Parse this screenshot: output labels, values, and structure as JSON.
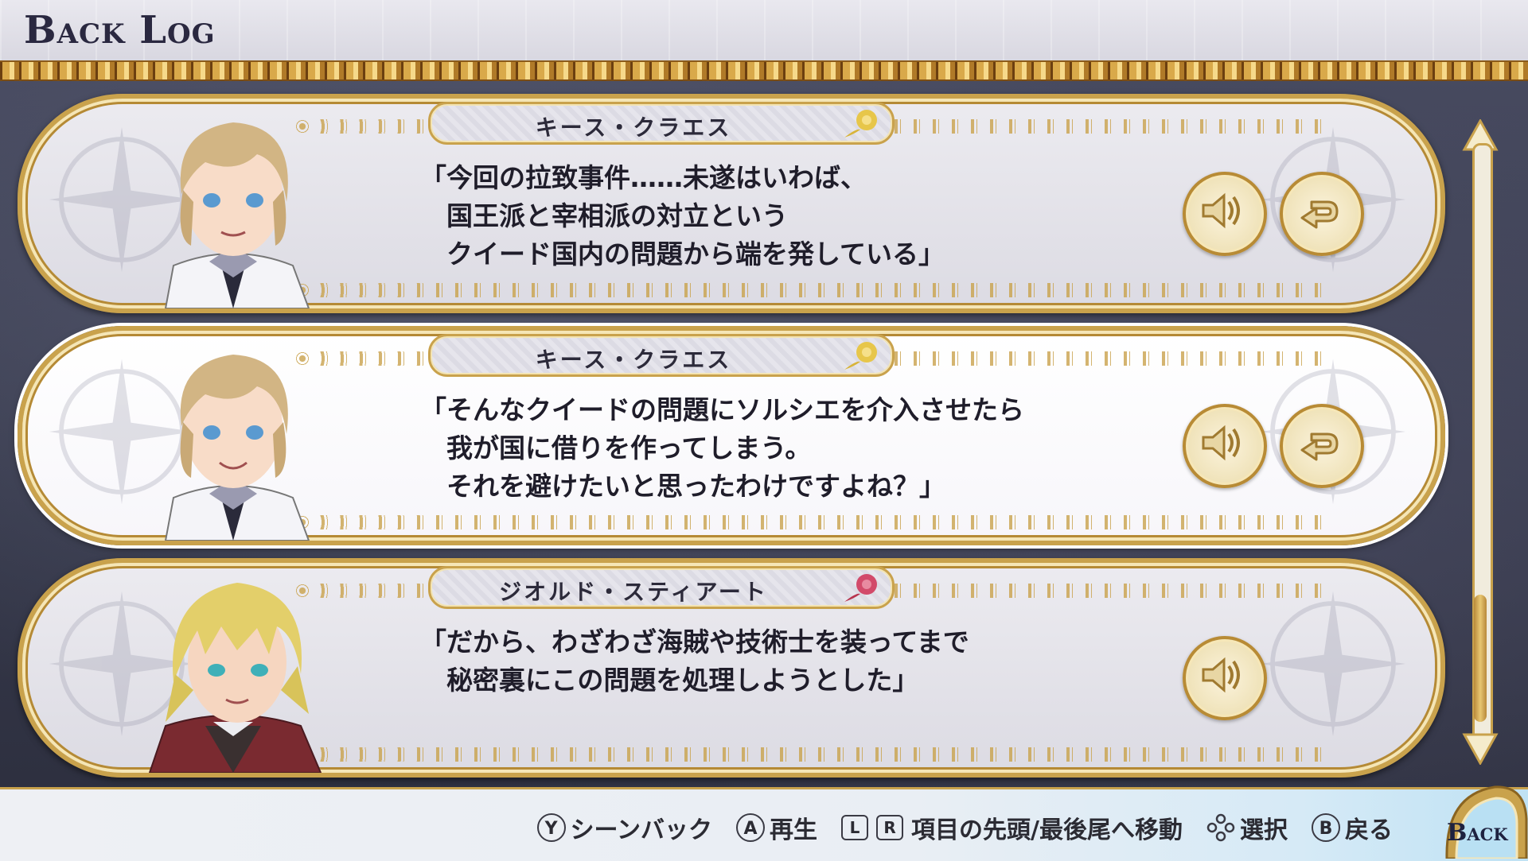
{
  "header": {
    "title": "Back Log"
  },
  "entries": [
    {
      "speaker": "キース・クラエス",
      "lines": [
        "「今回の拉致事件……未遂はいわば、",
        "　国王派と宰相派の対立という",
        "　クイード国内の問題から端を発している」"
      ],
      "rose_color": "#e7c64a",
      "has_jump": true
    },
    {
      "speaker": "キース・クラエス",
      "lines": [
        "「そんなクイードの問題にソルシエを介入させたら",
        "　我が国に借りを作ってしまう。",
        "　それを避けたいと思ったわけですよね？」"
      ],
      "rose_color": "#e7c64a",
      "has_jump": true
    },
    {
      "speaker": "ジオルド・スティアート",
      "lines": [
        "「だから、わざわざ海賊や技術士を装ってまで",
        "　秘密裏にこの問題を処理しようとした」"
      ],
      "rose_color": "#d24a6a",
      "has_jump": false
    }
  ],
  "footer": {
    "hints": [
      {
        "button": "Y",
        "label": "シーンバック"
      },
      {
        "button": "A",
        "label": "再生"
      },
      {
        "button_l": "L",
        "button_r": "R",
        "label": "項目の先頭/最後尾へ移動"
      },
      {
        "button": "dpad",
        "label": "選択"
      },
      {
        "button": "B",
        "label": "戻る"
      }
    ],
    "back_label": "Back"
  }
}
